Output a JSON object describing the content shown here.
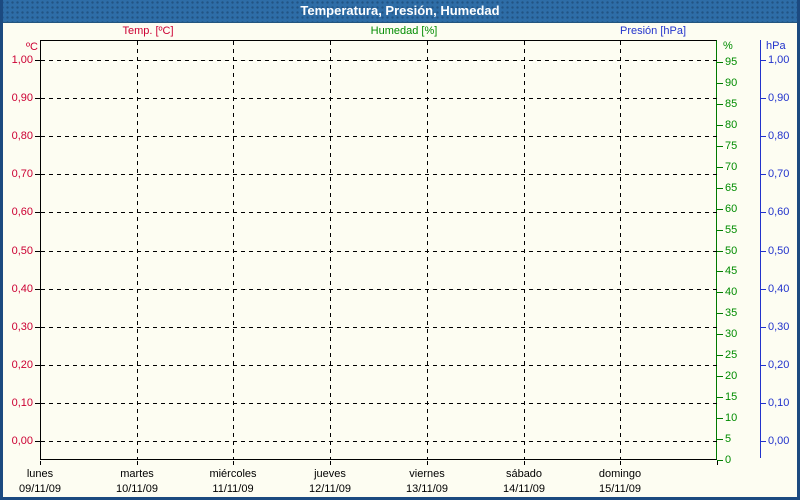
{
  "window": {
    "title": "Temperatura, Presión, Humedad",
    "titlebar_color": "#2e6da7",
    "frame_color": "#1c4a80",
    "background_color": "#fdfdf2"
  },
  "legend": {
    "items": [
      {
        "label": "Temp. [ºC]",
        "color": "#cc0033"
      },
      {
        "label": "Humedad [%]",
        "color": "#008c00"
      },
      {
        "label": "Presión [hPa]",
        "color": "#2233cc"
      }
    ]
  },
  "axes": {
    "left_temp": {
      "unit": "ºC",
      "color": "#cc0033",
      "ticks": [
        {
          "value": 0.0,
          "label": "0,00"
        },
        {
          "value": 0.1,
          "label": "0,10"
        },
        {
          "value": 0.2,
          "label": "0,20"
        },
        {
          "value": 0.3,
          "label": "0,30"
        },
        {
          "value": 0.4,
          "label": "0,40"
        },
        {
          "value": 0.5,
          "label": "0,50"
        },
        {
          "value": 0.6,
          "label": "0,60"
        },
        {
          "value": 0.7,
          "label": "0,70"
        },
        {
          "value": 0.8,
          "label": "0,80"
        },
        {
          "value": 0.9,
          "label": "0,90"
        },
        {
          "value": 1.0,
          "label": "1,00"
        }
      ]
    },
    "right_humidity": {
      "unit": "%",
      "color": "#008c00",
      "axis_color": "#007a00",
      "ticks": [
        0,
        5,
        10,
        15,
        20,
        25,
        30,
        35,
        40,
        45,
        50,
        55,
        60,
        65,
        70,
        75,
        80,
        85,
        90,
        95
      ]
    },
    "right_pressure": {
      "unit": "hPa",
      "color": "#2233cc",
      "ticks": [
        {
          "value": 0.0,
          "label": "0,00"
        },
        {
          "value": 0.1,
          "label": "0,10"
        },
        {
          "value": 0.2,
          "label": "0,20"
        },
        {
          "value": 0.3,
          "label": "0,30"
        },
        {
          "value": 0.4,
          "label": "0,40"
        },
        {
          "value": 0.5,
          "label": "0,50"
        },
        {
          "value": 0.6,
          "label": "0,60"
        },
        {
          "value": 0.7,
          "label": "0,70"
        },
        {
          "value": 0.8,
          "label": "0,80"
        },
        {
          "value": 0.9,
          "label": "0,90"
        },
        {
          "value": 1.0,
          "label": "1,00"
        }
      ]
    }
  },
  "x_axis": {
    "days": [
      {
        "name": "lunes",
        "date": "09/11/09"
      },
      {
        "name": "martes",
        "date": "10/11/09"
      },
      {
        "name": "miércoles",
        "date": "11/11/09"
      },
      {
        "name": "jueves",
        "date": "12/11/09"
      },
      {
        "name": "viernes",
        "date": "13/11/09"
      },
      {
        "name": "sábado",
        "date": "14/11/09"
      },
      {
        "name": "domingo",
        "date": "15/11/09"
      }
    ]
  },
  "chart_data": {
    "type": "line",
    "title": "Temperatura, Presión, Humedad",
    "x_categories": [
      "lunes 09/11/09",
      "martes 10/11/09",
      "miércoles 11/11/09",
      "jueves 12/11/09",
      "viernes 13/11/09",
      "sábado 14/11/09",
      "domingo 15/11/09"
    ],
    "grid": true,
    "axes": [
      {
        "name": "Temp. [ºC]",
        "side": "left",
        "range": [
          0,
          1
        ],
        "tick_step": 0.1,
        "color": "#cc0033"
      },
      {
        "name": "Humedad [%]",
        "side": "right",
        "range": [
          0,
          100
        ],
        "tick_step": 5,
        "color": "#008c00"
      },
      {
        "name": "Presión [hPa]",
        "side": "right",
        "range": [
          0,
          1
        ],
        "tick_step": 0.1,
        "color": "#2233cc"
      }
    ],
    "series": []
  }
}
